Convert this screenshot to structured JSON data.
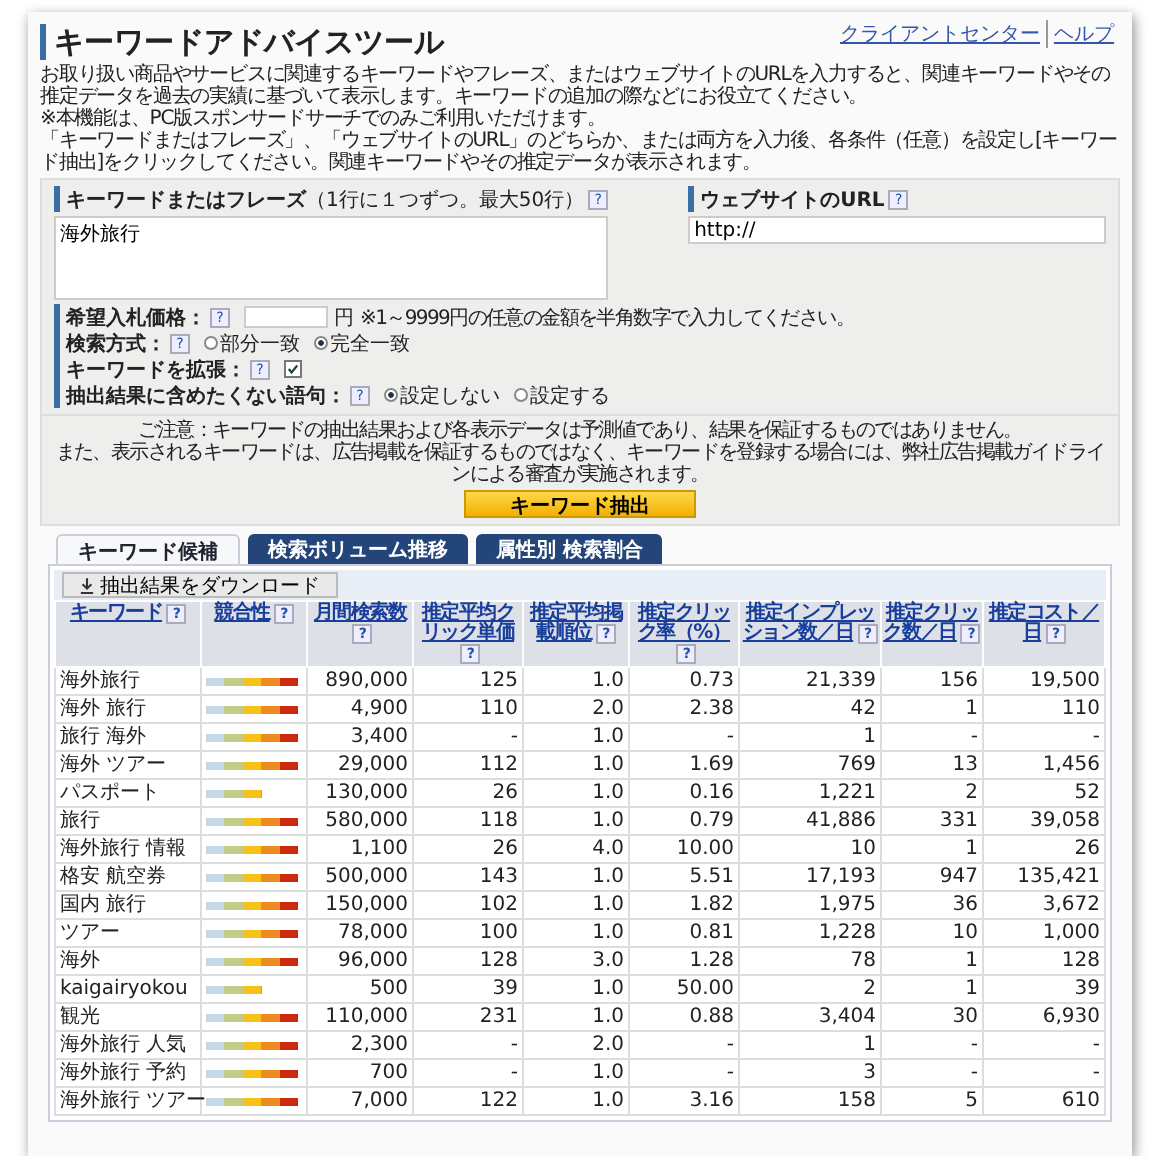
{
  "header": {
    "title": "キーワードアドバイスツール",
    "links": [
      "クライアントセンター",
      "ヘルプ"
    ]
  },
  "description": [
    "お取り扱い商品やサービスに関連するキーワードやフレーズ、またはウェブサイトのURLを入力すると、関連キーワードやその推定データを過去の実績に基づいて表示します。キーワードの追加の際などにお役立てください。",
    "※本機能は、PC版スポンサードサーチでのみご利用いただけます。",
    "「キーワードまたはフレーズ」、「ウェブサイトのURL」のどちらか、または両方を入力後、各条件（任意）を設定し[キーワード抽出]をクリックしてください。関連キーワードやその推定データが表示されます。"
  ],
  "form": {
    "keywords": {
      "label": "キーワードまたはフレーズ",
      "note": "（1行に１つずつ。最大50行）",
      "help": "?",
      "value": "海外旅行"
    },
    "url": {
      "label": "ウェブサイトのURL",
      "help": "?",
      "value": "http://"
    },
    "options": [
      {
        "kind": "price",
        "label": "希望入札価格：",
        "help": "?",
        "unit": "円",
        "note": "※1～9999円の任意の金額を半角数字で入力してください。"
      },
      {
        "kind": "radio",
        "label": "検索方式：",
        "help": "?",
        "choices": [
          {
            "label": "部分一致",
            "selected": false
          },
          {
            "label": "完全一致",
            "selected": true
          }
        ]
      },
      {
        "kind": "checkbox",
        "label": "キーワードを拡張：",
        "help": "?",
        "checked": true
      },
      {
        "kind": "radio",
        "label": "抽出結果に含めたくない語句：",
        "help": "?",
        "choices": [
          {
            "label": "設定しない",
            "selected": true
          },
          {
            "label": "設定する",
            "selected": false
          }
        ]
      }
    ]
  },
  "notice": [
    "ご注意：キーワードの抽出結果および各表示データは予測値であり、結果を保証するものではありません。",
    "また、表示されるキーワードは、広告掲載を保証するものではなく、キーワードを登録する場合には、弊社広告掲載ガイドラインによる審査が実施されます。"
  ],
  "submit": "キーワード抽出",
  "tabs": [
    {
      "label": "キーワード候補",
      "selected": true
    },
    {
      "label": "検索ボリューム推移",
      "selected": false
    },
    {
      "label": "属性別 検索割合",
      "selected": false
    }
  ],
  "download": "抽出結果をダウンロード",
  "table": {
    "columns": [
      {
        "label": "キーワード",
        "help": "?"
      },
      {
        "label": "競合性",
        "help": "?"
      },
      {
        "label": "月間検索数",
        "help": "?"
      },
      {
        "label": "推定平均クリック単価",
        "help": "?"
      },
      {
        "label": "推定平均掲載順位",
        "help": "?"
      },
      {
        "label": "推定クリック率（%）",
        "help": "?"
      },
      {
        "label": "推定インプレッション数／日",
        "help": "?"
      },
      {
        "label": "推定クリック数／日",
        "help": "?"
      },
      {
        "label": "推定コスト／日",
        "help": "?"
      }
    ],
    "rows": [
      {
        "cells": [
          "海外旅行",
          {
            "level": 1
          },
          "890,000",
          "125",
          "1.0",
          "0.73",
          "21,339",
          "156",
          "19,500"
        ]
      },
      {
        "cells": [
          "海外 旅行",
          {
            "level": 1
          },
          "4,900",
          "110",
          "2.0",
          "2.38",
          "42",
          "1",
          "110"
        ]
      },
      {
        "cells": [
          "旅行 海外",
          {
            "level": 1
          },
          "3,400",
          "-",
          "1.0",
          "-",
          "1",
          "-",
          "-"
        ]
      },
      {
        "cells": [
          "海外 ツアー",
          {
            "level": 1
          },
          "29,000",
          "112",
          "1.0",
          "1.69",
          "769",
          "13",
          "1,456"
        ]
      },
      {
        "cells": [
          "パスポート",
          {
            "level": 0.6
          },
          "130,000",
          "26",
          "1.0",
          "0.16",
          "1,221",
          "2",
          "52"
        ]
      },
      {
        "cells": [
          "旅行",
          {
            "level": 1
          },
          "580,000",
          "118",
          "1.0",
          "0.79",
          "41,886",
          "331",
          "39,058"
        ]
      },
      {
        "cells": [
          "海外旅行 情報",
          {
            "level": 1
          },
          "1,100",
          "26",
          "4.0",
          "10.00",
          "10",
          "1",
          "26"
        ]
      },
      {
        "cells": [
          "格安 航空券",
          {
            "level": 1
          },
          "500,000",
          "143",
          "1.0",
          "5.51",
          "17,193",
          "947",
          "135,421"
        ]
      },
      {
        "cells": [
          "国内 旅行",
          {
            "level": 1
          },
          "150,000",
          "102",
          "1.0",
          "1.82",
          "1,975",
          "36",
          "3,672"
        ]
      },
      {
        "cells": [
          "ツアー",
          {
            "level": 1
          },
          "78,000",
          "100",
          "1.0",
          "0.81",
          "1,228",
          "10",
          "1,000"
        ]
      },
      {
        "cells": [
          "海外",
          {
            "level": 1
          },
          "96,000",
          "128",
          "3.0",
          "1.28",
          "78",
          "1",
          "128"
        ]
      },
      {
        "cells": [
          "kaigairyokou",
          {
            "level": 0.6
          },
          "500",
          "39",
          "1.0",
          "50.00",
          "2",
          "1",
          "39"
        ]
      },
      {
        "cells": [
          "観光",
          {
            "level": 1
          },
          "110,000",
          "231",
          "1.0",
          "0.88",
          "3,404",
          "30",
          "6,930"
        ]
      },
      {
        "cells": [
          "海外旅行 人気",
          {
            "level": 1
          },
          "2,300",
          "-",
          "2.0",
          "-",
          "1",
          "-",
          "-"
        ]
      },
      {
        "cells": [
          "海外旅行 予約",
          {
            "level": 1
          },
          "700",
          "-",
          "1.0",
          "-",
          "3",
          "-",
          "-"
        ]
      },
      {
        "cells": [
          "海外旅行 ツアー",
          {
            "level": 1
          },
          "7,000",
          "122",
          "1.0",
          "3.16",
          "158",
          "5",
          "610"
        ]
      }
    ]
  }
}
